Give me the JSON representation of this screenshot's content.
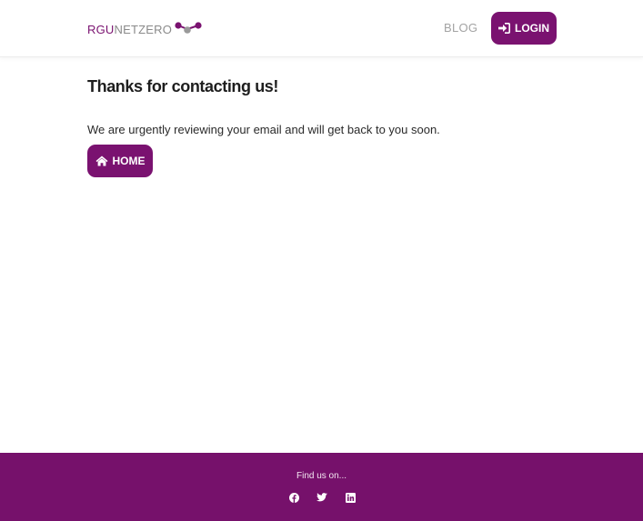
{
  "header": {
    "logo": {
      "part1": "RGU",
      "part2": "NETZERO",
      "colors": {
        "primary": "#7a1270",
        "secondary": "#8a8a8a",
        "dot_gray": "#9a9a9a"
      }
    },
    "nav": {
      "blog_label": "BLOG",
      "login_label": "LOGIN",
      "login_icon": "sign-in-icon"
    }
  },
  "main": {
    "title": "Thanks for contacting us!",
    "message": "We are urgently reviewing your email and will get back to you soon.",
    "home_button": {
      "label": "HOME",
      "icon": "home-icon"
    }
  },
  "footer": {
    "find_us": "Find us on...",
    "social": [
      {
        "name": "facebook",
        "icon": "facebook-icon"
      },
      {
        "name": "twitter",
        "icon": "twitter-icon"
      },
      {
        "name": "linkedin",
        "icon": "linkedin-icon"
      }
    ]
  },
  "colors": {
    "accent": "#7a1270",
    "footer_bg": "#76116b",
    "nav_text": "#a3a3a3",
    "text": "#222222"
  }
}
